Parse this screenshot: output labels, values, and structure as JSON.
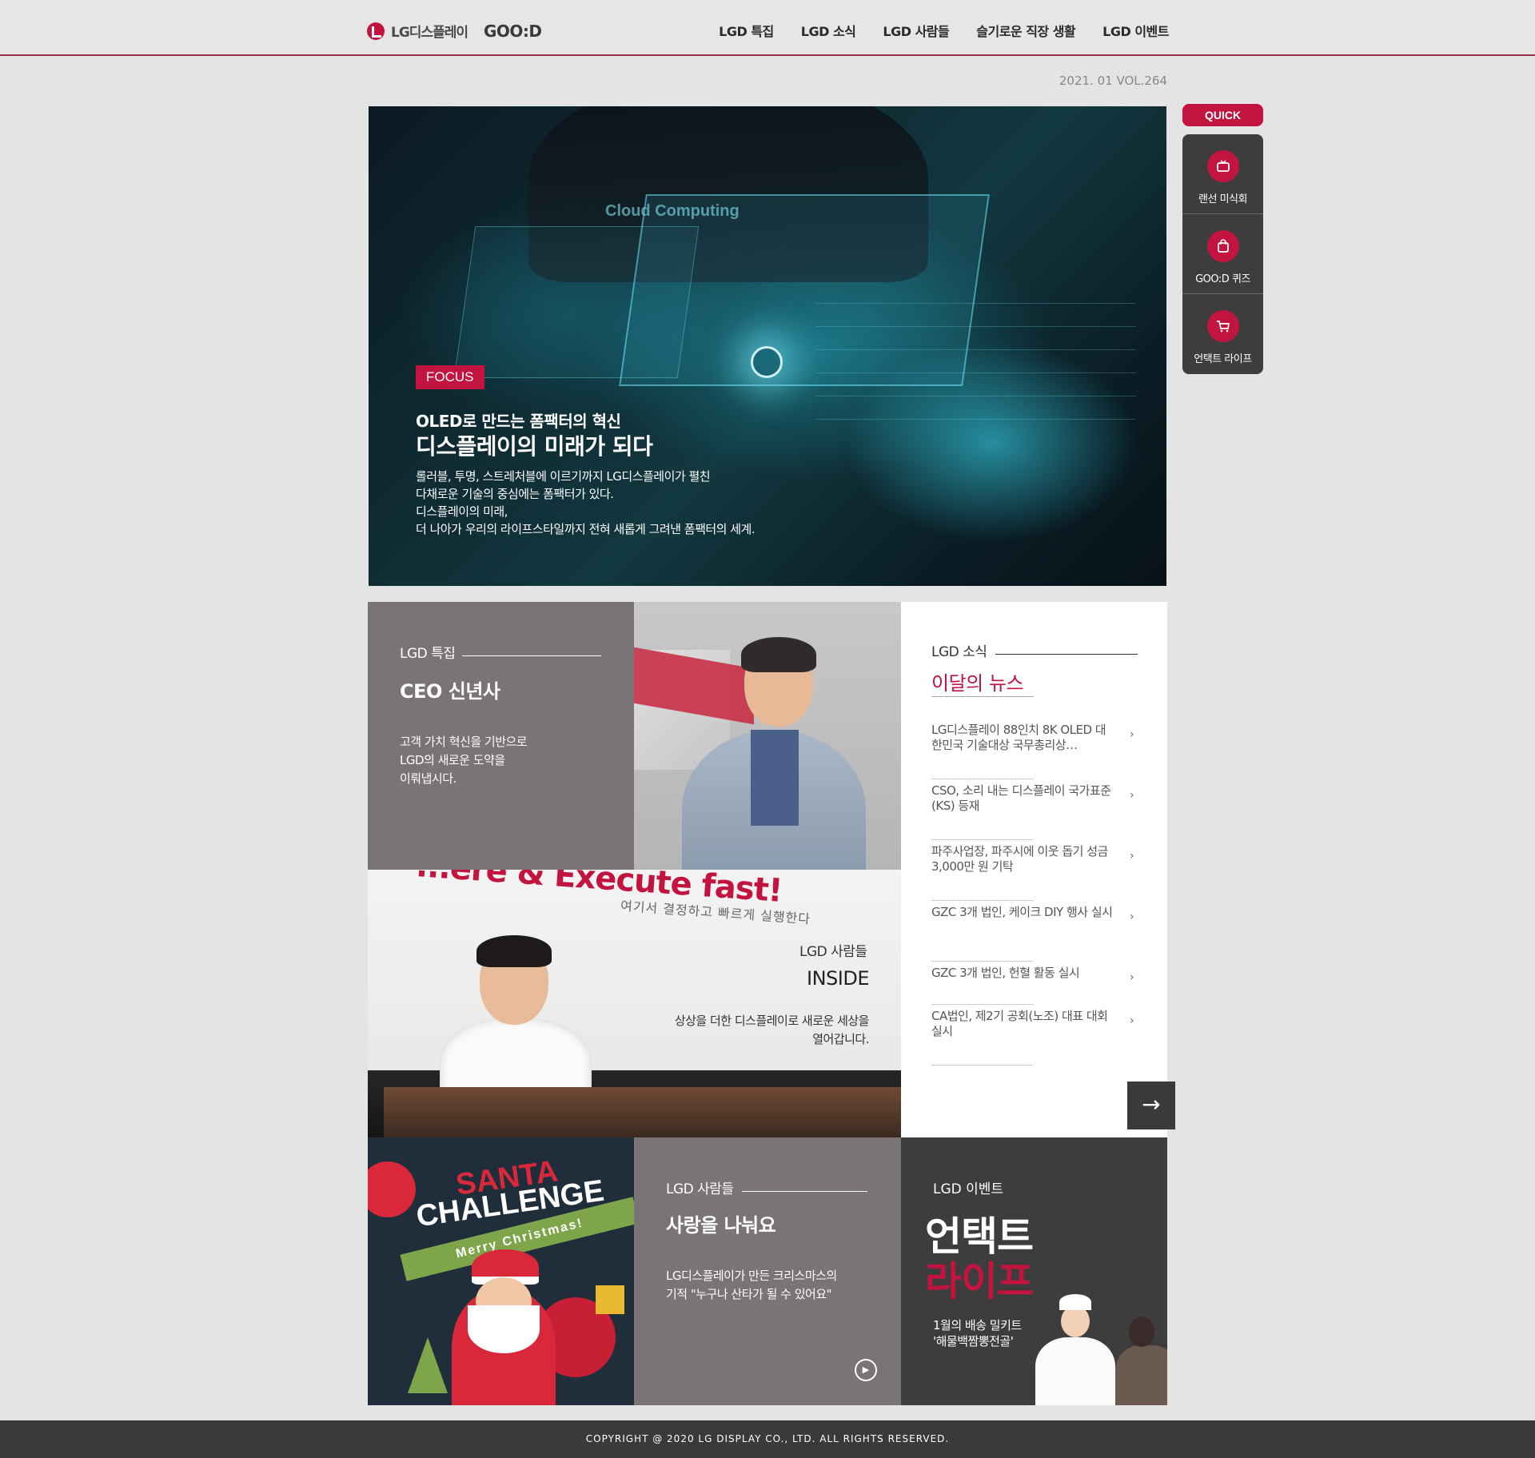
{
  "brand": {
    "logo_text": "LG디스플레이",
    "magazine": "GOO:D"
  },
  "nav": {
    "items": [
      "LGD 특집",
      "LGD 소식",
      "LGD 사람들",
      "슬기로운 직장 생활",
      "LGD 이벤트"
    ]
  },
  "issue": "2021. 01 VOL.264",
  "hero": {
    "badge": "FOCUS",
    "image_text": "Cloud Computing",
    "subtitle": "OLED로 만드는 폼팩터의 혁신",
    "title": "디스플레이의 미래가 되다",
    "desc": [
      "롤러블, 투명, 스트레처블에 이르기까지 LG디스플레이가 펼친",
      "다채로운 기술의 중심에는 폼팩터가 있다.",
      "디스플레이의 미래,",
      "더 나아가 우리의 라이프스타일까지 전혀 새롭게 그려낸 폼팩터의 세계."
    ]
  },
  "quick": {
    "label": "QUICK",
    "items": [
      {
        "label": "랜선 미식회",
        "icon": "tv-icon"
      },
      {
        "label": "GOO:D 퀴즈",
        "icon": "bag-icon"
      },
      {
        "label": "언택트 라이프",
        "icon": "cart-icon"
      }
    ]
  },
  "feature": {
    "category": "LGD 특집",
    "title": "CEO 신년사",
    "desc": [
      "고객 가치 혁신을 기반으로",
      "LGD의 새로운 도약을",
      "이뤄냅시다."
    ]
  },
  "news": {
    "category": "LGD 소식",
    "title": "이달의 뉴스",
    "items": [
      "LG디스플레이 88인치 8K OLED 대한민국 기술대상 국무총리상…",
      "CSO, 소리 내는 디스플레이 국가표준(KS) 등재",
      "파주사업장, 파주시에 이웃 돕기 성금 3,000만 원 기탁",
      "GZC 3개 법인, 케이크 DIY 행사 실시",
      "GZC 3개 법인, 헌혈 활동 실시",
      "CA법인, 제2기 공회(노조) 대표 대회 실시"
    ]
  },
  "inside": {
    "category": "LGD 사람들",
    "title": "INSIDE",
    "slogan": "...ere & Execute fast!",
    "slogan_ko": "여기서 결정하고 빠르게 실행한다",
    "desc": [
      "상상을 더한 디스플레이로 새로운 세상을",
      "열어갑니다."
    ]
  },
  "santa": {
    "line1": "SANTA",
    "line2": "CHALLENGE",
    "ribbon": "Merry Christmas!"
  },
  "share": {
    "category": "LGD 사람들",
    "title": "사랑을 나눠요",
    "desc": [
      "LG디스플레이가 만든 크리스마스의",
      "기적 \"누구나 산타가 될 수 있어요\""
    ]
  },
  "event": {
    "category": "LGD 이벤트",
    "big1": "언택트",
    "big2": "라이프",
    "desc": [
      "1월의 배송 밀키트",
      "'해물백짬뽕전골'"
    ]
  },
  "footer": "COPYRIGHT @ 2020 LG DISPLAY CO., LTD. ALL RIGHTS RESERVED.",
  "colors": {
    "accent": "#c3143f",
    "dark": "#3a3a3a",
    "taupe": "#7a7474",
    "bg": "#e4e4e4"
  }
}
